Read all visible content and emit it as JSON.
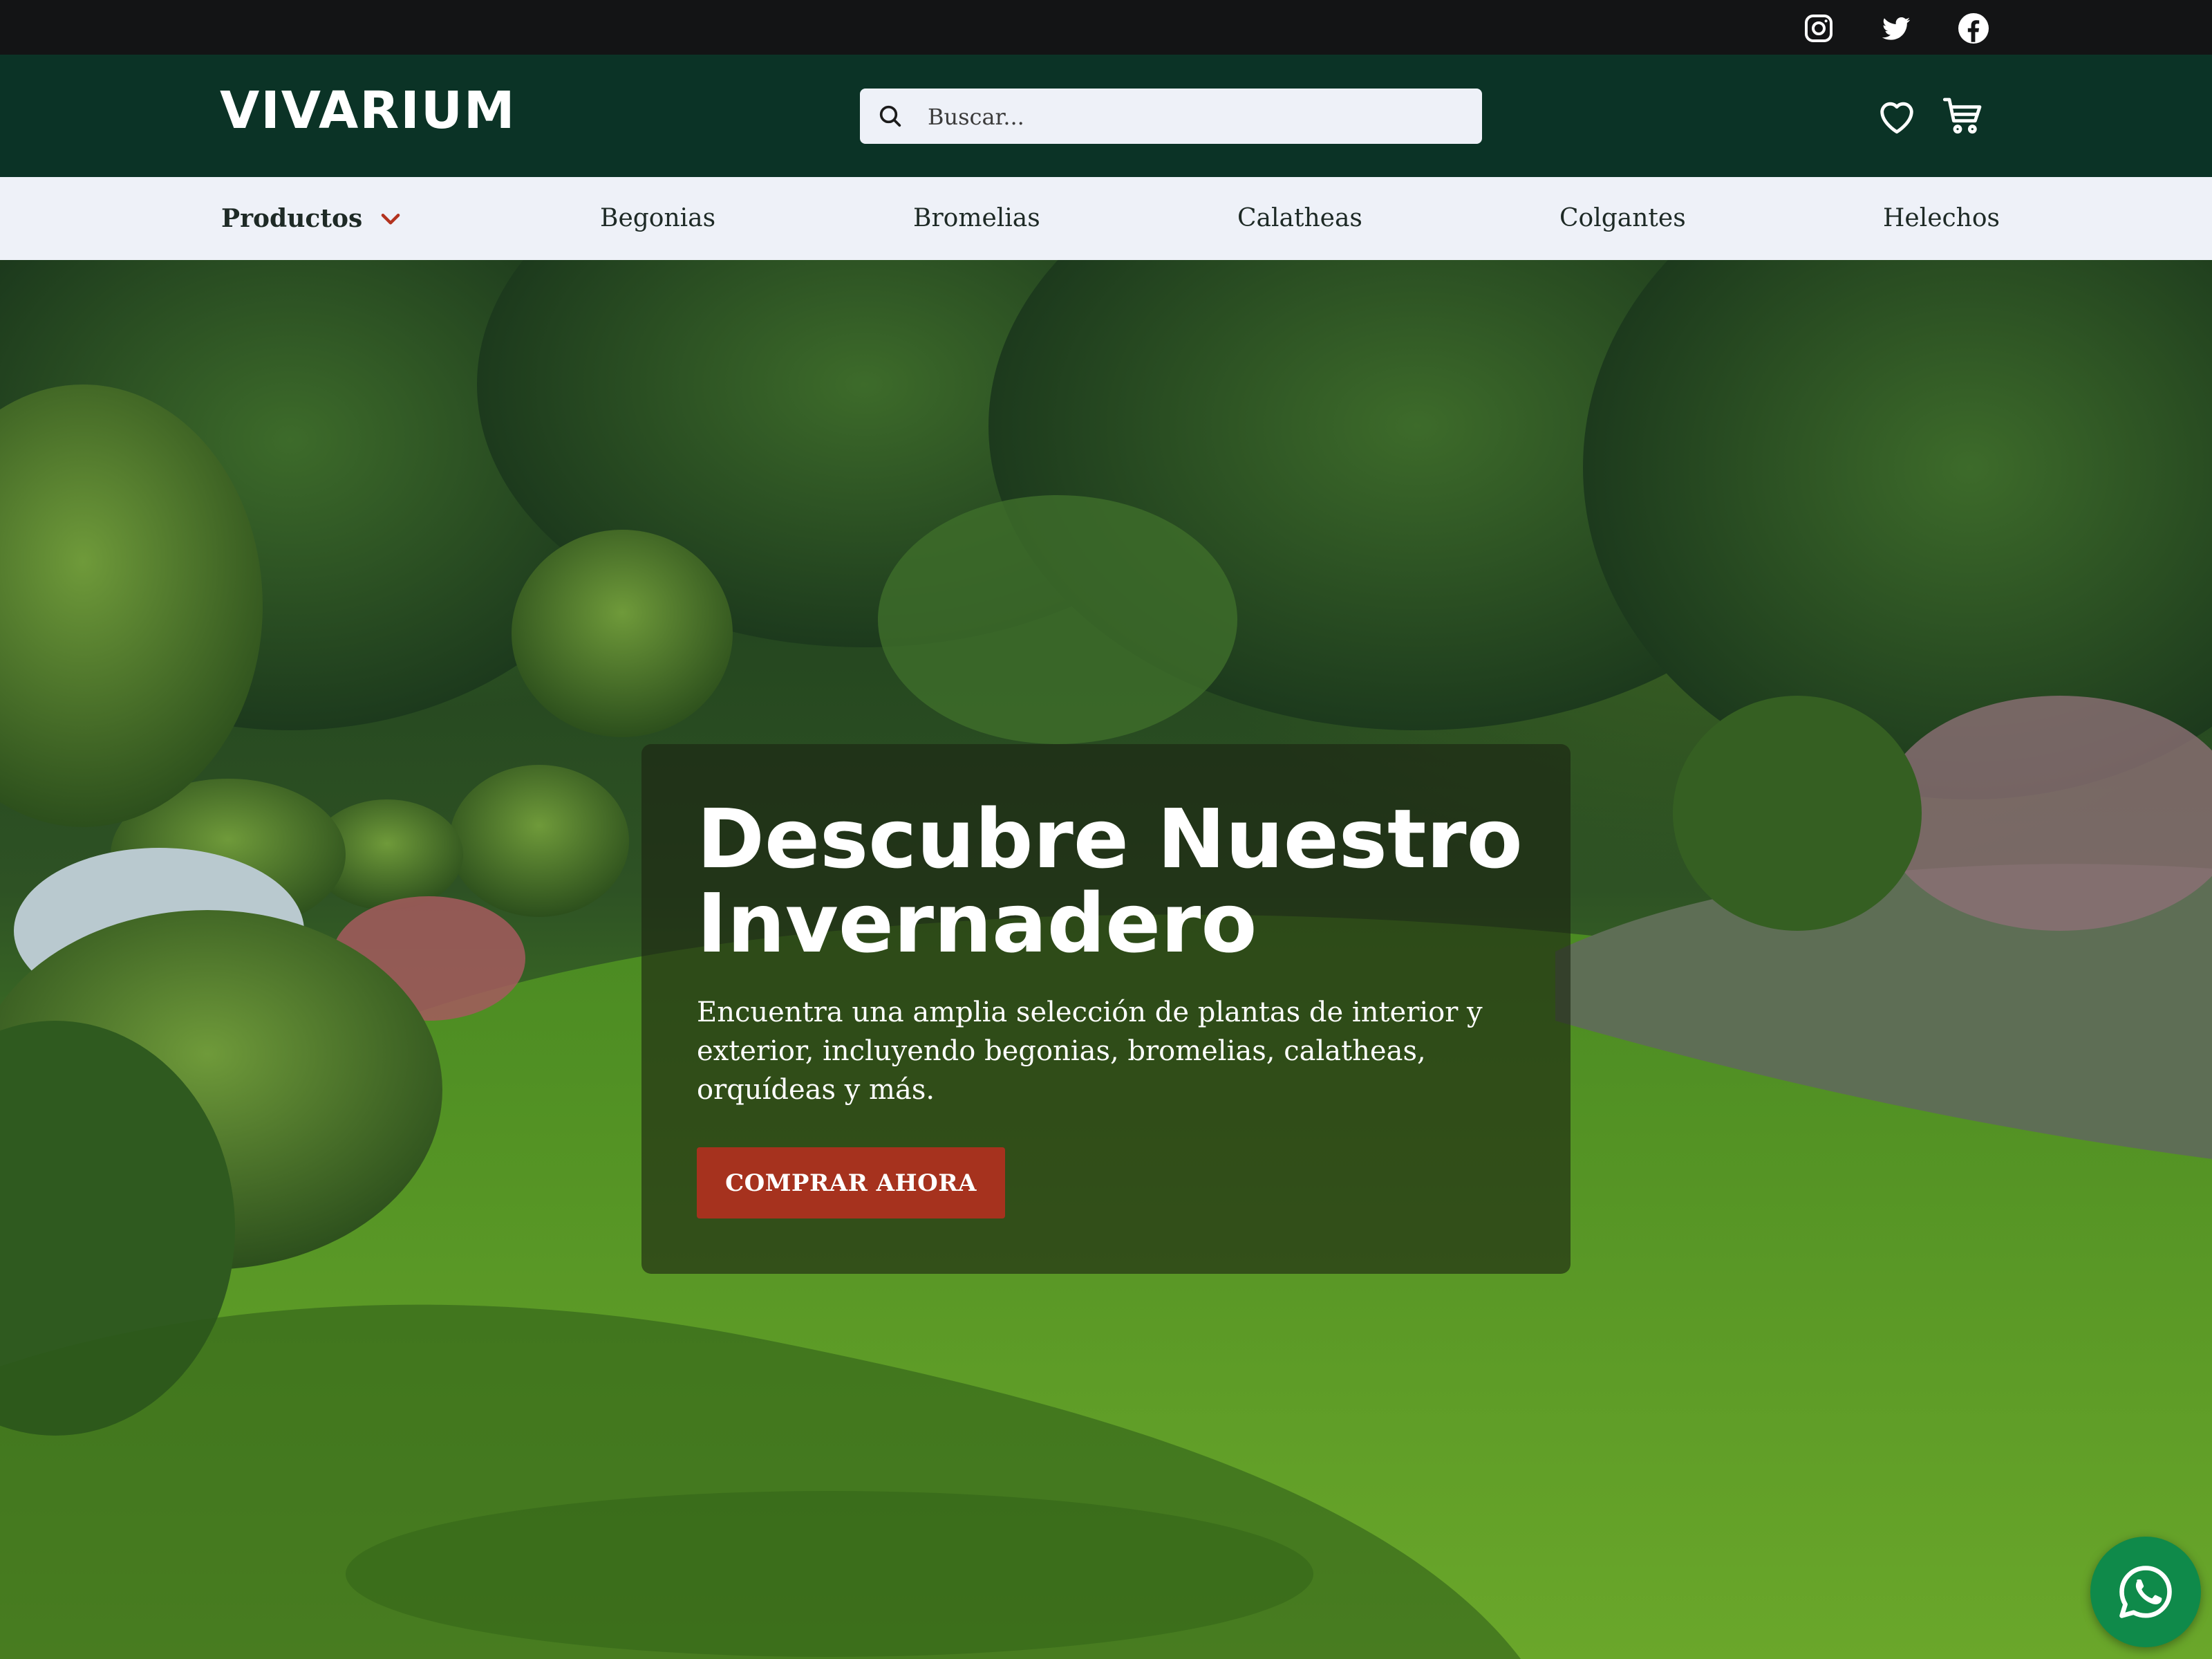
{
  "topbar": {
    "social": [
      {
        "name": "instagram-icon"
      },
      {
        "name": "twitter-icon"
      },
      {
        "name": "facebook-icon"
      }
    ]
  },
  "header": {
    "logo": "VIVARIUM",
    "search_placeholder": "Buscar...",
    "icons": [
      "heart-icon",
      "cart-icon"
    ]
  },
  "nav": {
    "items": [
      {
        "label": "Productos",
        "has_dropdown": true
      },
      {
        "label": "Begonias"
      },
      {
        "label": "Bromelias"
      },
      {
        "label": "Calatheas"
      },
      {
        "label": "Colgantes"
      },
      {
        "label": "Helechos"
      }
    ]
  },
  "hero": {
    "title": "Descubre Nuestro Invernadero",
    "text": "Encuentra una amplia selección de plantas de interior y exterior, incluyendo begonias, bromelias, calatheas, orquídeas y más.",
    "cta": "COMPRAR AHORA"
  },
  "colors": {
    "topbar": "#131415",
    "header": "#0b3326",
    "nav": "#eef1f8",
    "accent": "#a6321e",
    "whatsapp": "#0f8a4a"
  }
}
